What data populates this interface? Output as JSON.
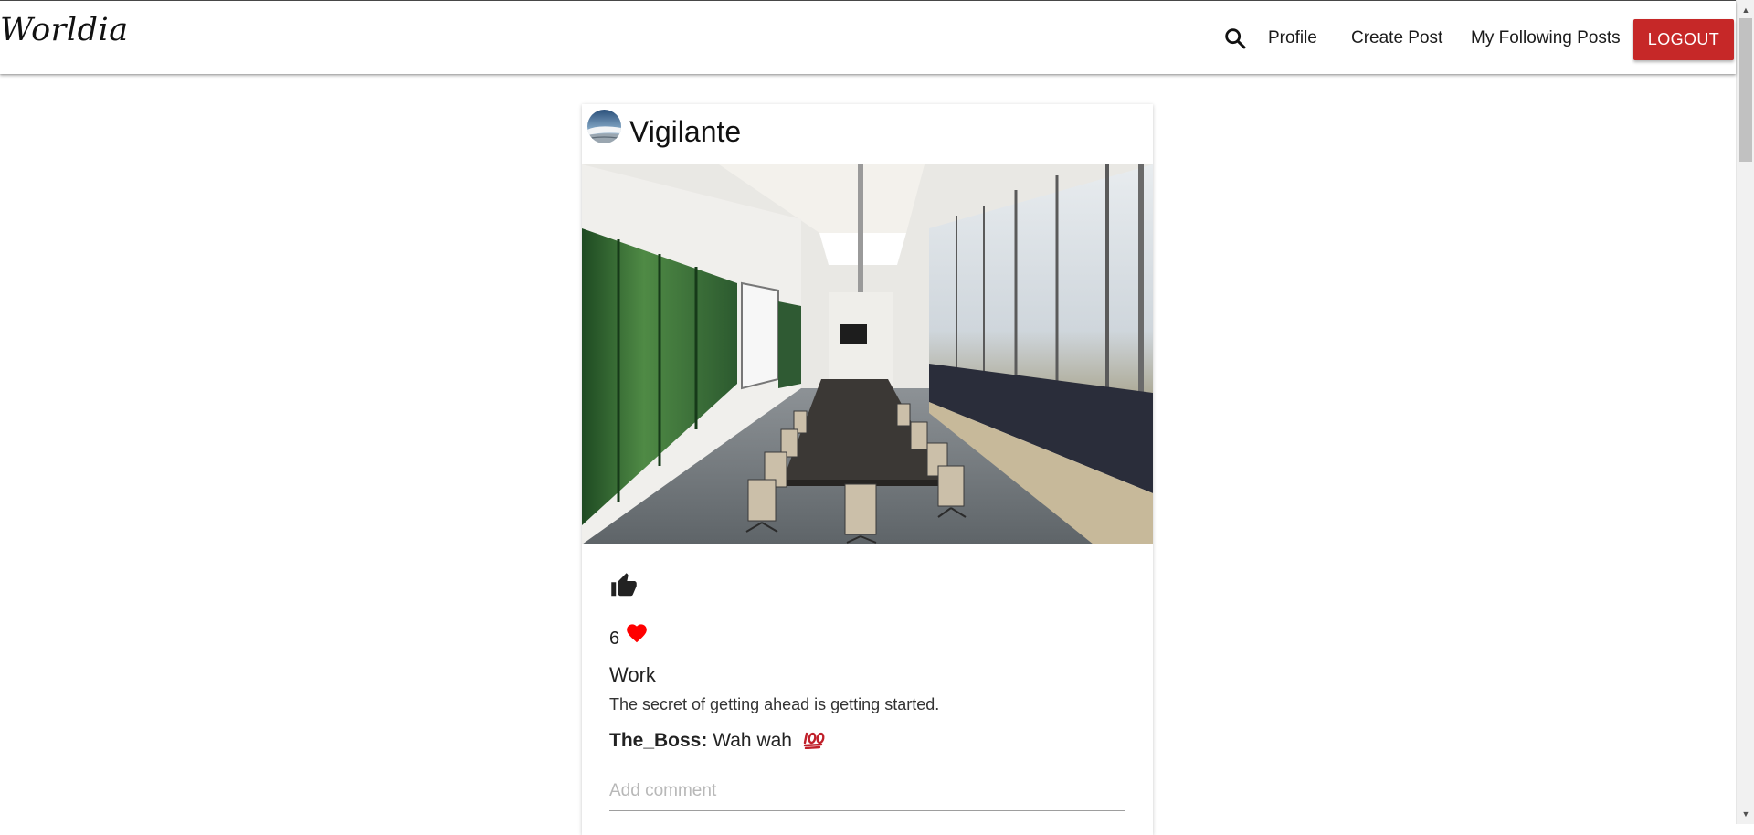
{
  "navbar": {
    "brand": "Worldia",
    "search_icon": "search-icon",
    "links": {
      "profile": "Profile",
      "create_post": "Create Post",
      "following_posts": "My Following Posts"
    },
    "logout_label": "LOGOUT"
  },
  "post": {
    "username": "Vigilante",
    "avatar_icon": "avatar-landscape-icon",
    "image_description_icon": "conference-room-photo",
    "like_icon": "thumbs-up-icon",
    "likes_count": "6",
    "heart_icon": "heart-icon",
    "title": "Work",
    "body": "The secret of getting ahead is getting started.",
    "comments": [
      {
        "author": "The_Boss:",
        "text": "Wah wah",
        "emoji_icon": "hundred-points-icon"
      }
    ],
    "comment_placeholder": "Add comment"
  },
  "colors": {
    "logout_red": "#c62828",
    "heart_red": "#ff0000",
    "text_dark": "#222222"
  }
}
